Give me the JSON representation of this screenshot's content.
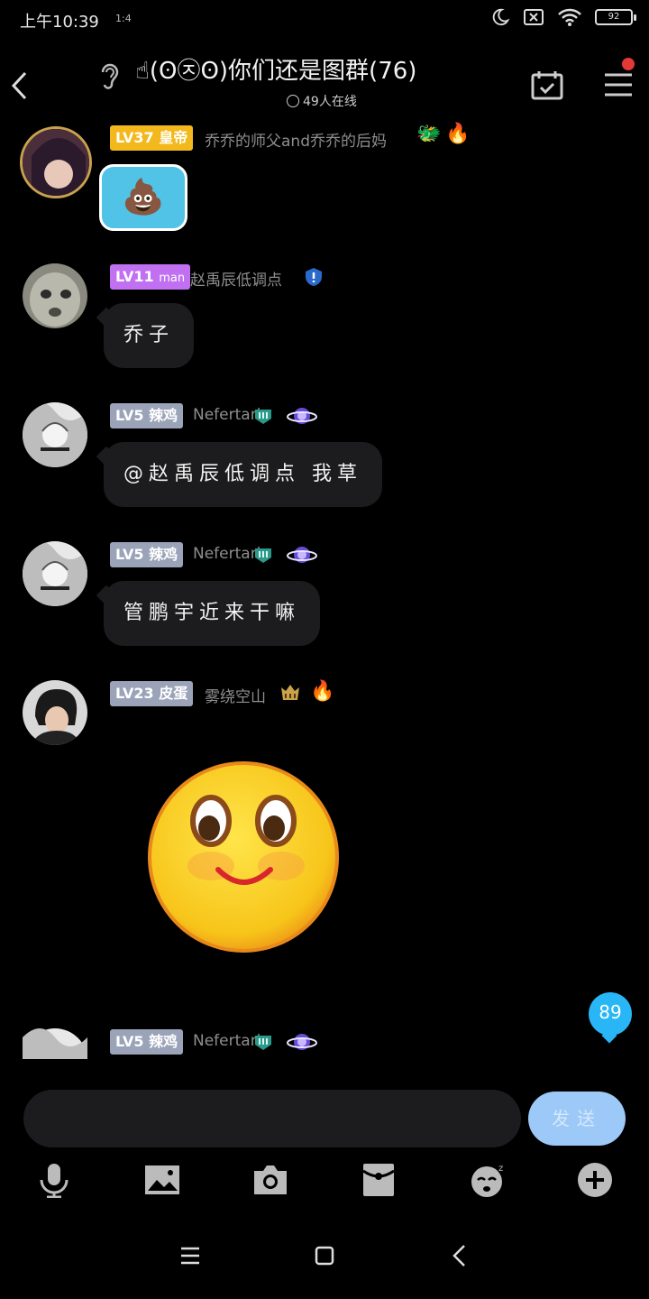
{
  "status_bar": {
    "time": "上午10:39",
    "mini": "1:4",
    "battery": "92"
  },
  "header": {
    "title": "☝(ʘ㉨ʘ)你们还是图群(76)",
    "online": "49人在线"
  },
  "messages": [
    {
      "level": "LV37",
      "title": "皇帝",
      "nickname": "乔乔的师父and乔乔的后妈",
      "level_color": "#f2b81c",
      "content": "💩"
    },
    {
      "level": "LV11",
      "title": "man",
      "nickname": "赵禹辰低调点",
      "level_color": "#c070f0",
      "content": "乔子"
    },
    {
      "level": "LV5",
      "title": "辣鸡",
      "nickname": "Nefertari",
      "level_color": "#9aa3b8",
      "content": "@赵禹辰低调点 我草"
    },
    {
      "level": "LV5",
      "title": "辣鸡",
      "nickname": "Nefertari",
      "level_color": "#9aa3b8",
      "content": "管鹏宇近来干嘛"
    },
    {
      "level": "LV23",
      "title": "皮蛋",
      "nickname": "雾绕空山",
      "level_color": "#9aa3b8"
    },
    {
      "level": "LV5",
      "title": "辣鸡",
      "nickname": "Nefertari",
      "level_color": "#9aa3b8"
    }
  ],
  "unread_count": "89",
  "input": {
    "value": "",
    "placeholder": ""
  },
  "send_label": "发送",
  "toolbar_icons": [
    "microphone-icon",
    "image-icon",
    "camera-icon",
    "red-packet-icon",
    "sticker-icon",
    "plus-icon"
  ],
  "nav_icons": [
    "menu-icon",
    "home-icon",
    "back-icon"
  ]
}
